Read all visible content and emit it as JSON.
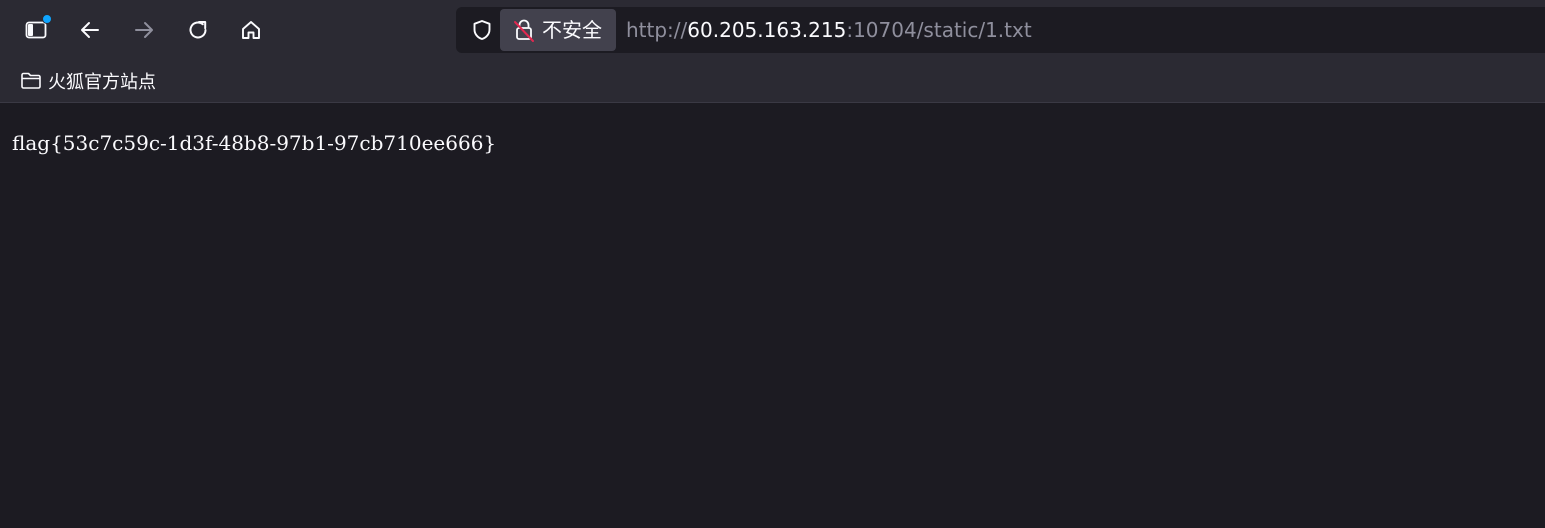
{
  "toolbar": {
    "icons": [
      "sidebar-icon",
      "back-arrow-icon",
      "forward-arrow-icon",
      "reload-icon",
      "home-icon"
    ]
  },
  "urlbar": {
    "security_label": "不安全",
    "url_scheme": "http://",
    "url_host": "60.205.163.215",
    "url_rest": ":10704/static/1.txt",
    "icons": [
      "shield-icon",
      "insecure-lock-icon"
    ]
  },
  "bookmarks": {
    "items": [
      {
        "label": "火狐官方站点",
        "icon": "folder-icon"
      }
    ]
  },
  "content": {
    "text": "flag{53c7c59c-1d3f-48b8-97b1-97cb710ee666}"
  },
  "colors": {
    "toolbar_bg": "#2b2a33",
    "page_bg": "#1c1b22",
    "accent_dot": "#0fa5ff",
    "insecure_strike": "#e22850"
  }
}
